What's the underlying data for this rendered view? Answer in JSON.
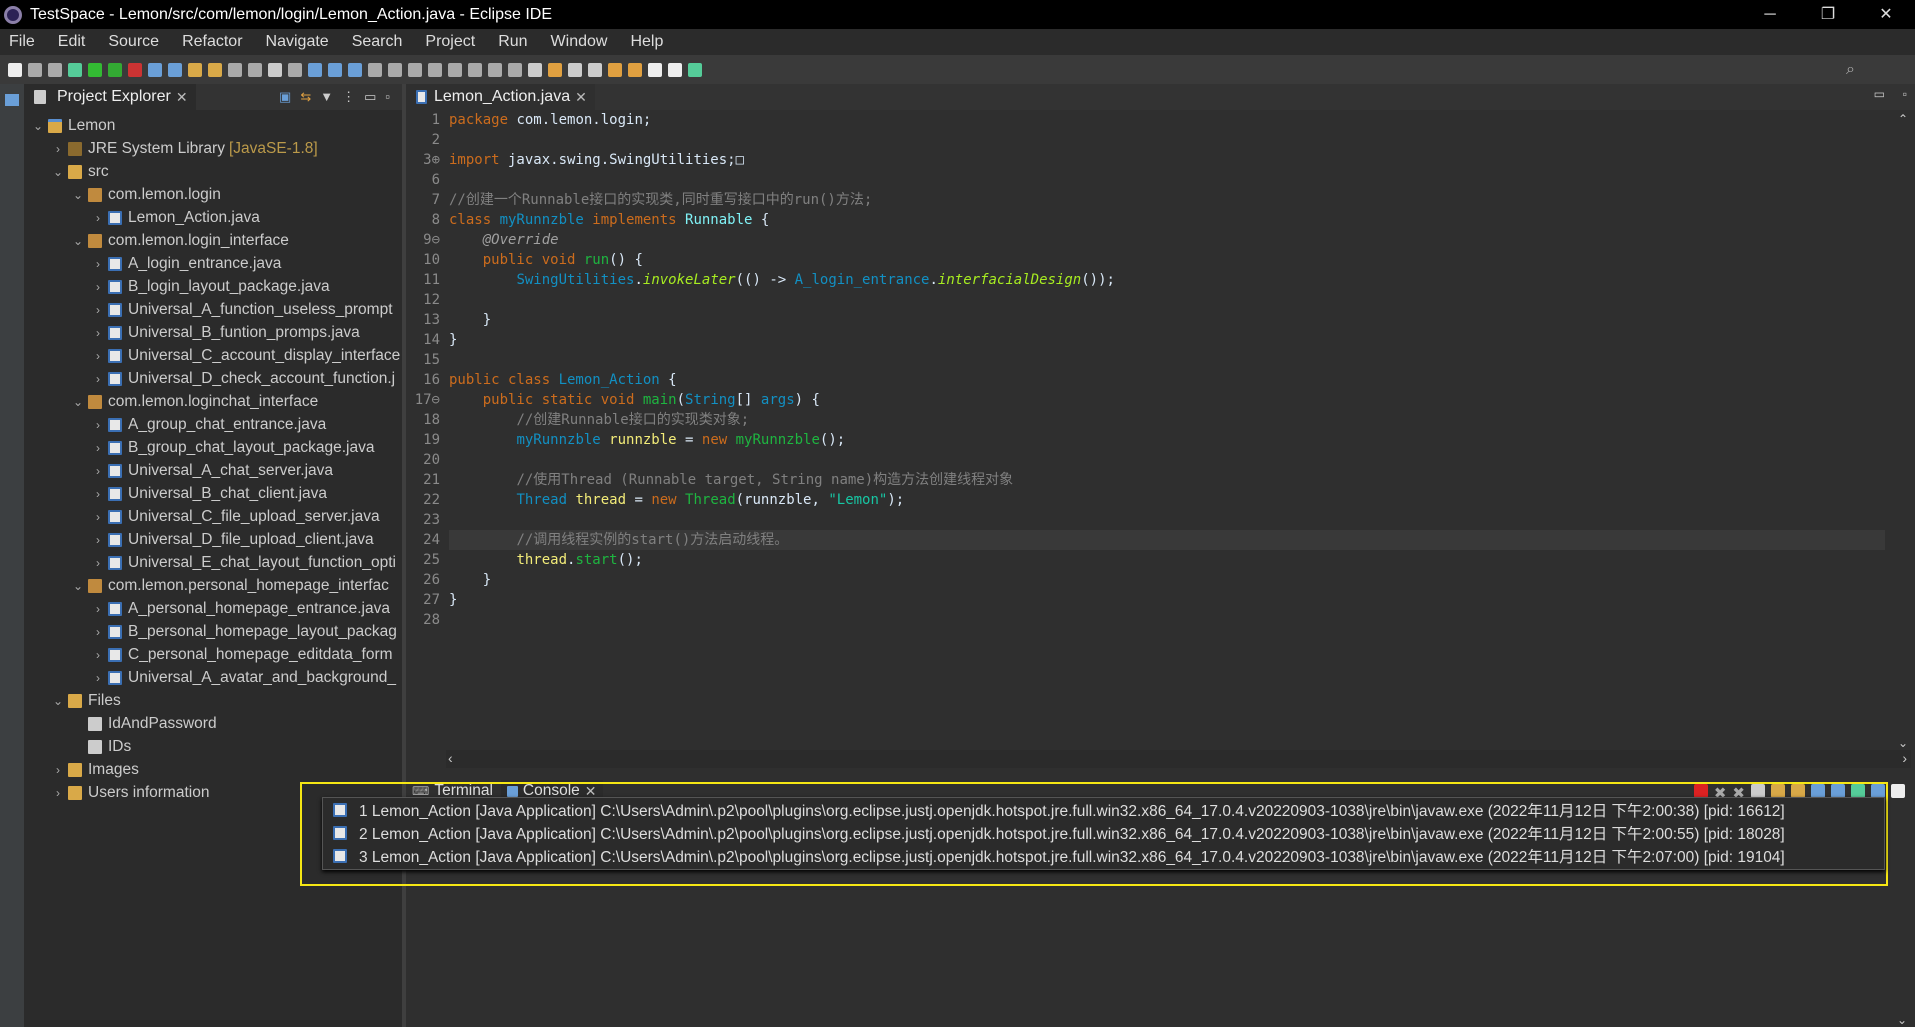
{
  "window": {
    "title": "TestSpace - Lemon/src/com/lemon/login/Lemon_Action.java - Eclipse IDE",
    "minimize": "─",
    "restore": "❐",
    "close": "✕"
  },
  "menu": [
    "File",
    "Edit",
    "Source",
    "Refactor",
    "Navigate",
    "Search",
    "Project",
    "Run",
    "Window",
    "Help"
  ],
  "explorer": {
    "title": "Project Explorer",
    "items": [
      {
        "depth": 0,
        "chev": "⌄",
        "icon": "project",
        "label": "Lemon"
      },
      {
        "depth": 1,
        "chev": "›",
        "icon": "library",
        "label": "JRE System Library",
        "decor": "[JavaSE-1.8]"
      },
      {
        "depth": 1,
        "chev": "⌄",
        "icon": "folder",
        "label": "src"
      },
      {
        "depth": 2,
        "chev": "⌄",
        "icon": "package",
        "label": "com.lemon.login"
      },
      {
        "depth": 3,
        "chev": "›",
        "icon": "java",
        "label": "Lemon_Action.java"
      },
      {
        "depth": 2,
        "chev": "⌄",
        "icon": "package",
        "label": "com.lemon.login_interface"
      },
      {
        "depth": 3,
        "chev": "›",
        "icon": "java",
        "label": "A_login_entrance.java"
      },
      {
        "depth": 3,
        "chev": "›",
        "icon": "java",
        "label": "B_login_layout_package.java"
      },
      {
        "depth": 3,
        "chev": "›",
        "icon": "java",
        "label": "Universal_A_function_useless_prompt"
      },
      {
        "depth": 3,
        "chev": "›",
        "icon": "java",
        "label": "Universal_B_funtion_promps.java"
      },
      {
        "depth": 3,
        "chev": "›",
        "icon": "java",
        "label": "Universal_C_account_display_interface"
      },
      {
        "depth": 3,
        "chev": "›",
        "icon": "java",
        "label": "Universal_D_check_account_function.j"
      },
      {
        "depth": 2,
        "chev": "⌄",
        "icon": "package",
        "label": "com.lemon.loginchat_interface"
      },
      {
        "depth": 3,
        "chev": "›",
        "icon": "java",
        "label": "A_group_chat_entrance.java"
      },
      {
        "depth": 3,
        "chev": "›",
        "icon": "java",
        "label": "B_group_chat_layout_package.java"
      },
      {
        "depth": 3,
        "chev": "›",
        "icon": "java",
        "label": "Universal_A_chat_server.java"
      },
      {
        "depth": 3,
        "chev": "›",
        "icon": "java",
        "label": "Universal_B_chat_client.java"
      },
      {
        "depth": 3,
        "chev": "›",
        "icon": "java",
        "label": "Universal_C_file_upload_server.java"
      },
      {
        "depth": 3,
        "chev": "›",
        "icon": "java",
        "label": "Universal_D_file_upload_client.java"
      },
      {
        "depth": 3,
        "chev": "›",
        "icon": "java",
        "label": "Universal_E_chat_layout_function_opti"
      },
      {
        "depth": 2,
        "chev": "⌄",
        "icon": "package",
        "label": "com.lemon.personal_homepage_interfac"
      },
      {
        "depth": 3,
        "chev": "›",
        "icon": "java",
        "label": "A_personal_homepage_entrance.java"
      },
      {
        "depth": 3,
        "chev": "›",
        "icon": "java",
        "label": "B_personal_homepage_layout_packag"
      },
      {
        "depth": 3,
        "chev": "›",
        "icon": "java",
        "label": "C_personal_homepage_editdata_form"
      },
      {
        "depth": 3,
        "chev": "›",
        "icon": "java",
        "label": "Universal_A_avatar_and_background_"
      },
      {
        "depth": 1,
        "chev": "⌄",
        "icon": "folder",
        "label": "Files"
      },
      {
        "depth": 2,
        "chev": "",
        "icon": "file",
        "label": "IdAndPassword"
      },
      {
        "depth": 2,
        "chev": "",
        "icon": "file",
        "label": "IDs"
      },
      {
        "depth": 1,
        "chev": "›",
        "icon": "folder",
        "label": "Images"
      },
      {
        "depth": 1,
        "chev": "›",
        "icon": "folder",
        "label": "Users information"
      }
    ]
  },
  "editor": {
    "tab": "Lemon_Action.java",
    "lines": [
      {
        "n": "1",
        "s": [
          [
            "kw",
            "package"
          ],
          [
            "plain",
            " com.lemon.login;"
          ]
        ]
      },
      {
        "n": "2",
        "s": []
      },
      {
        "n": "3⊕",
        "s": [
          [
            "kw",
            "import"
          ],
          [
            "plain",
            " javax.swing.SwingUtilities;□"
          ]
        ]
      },
      {
        "n": "6",
        "s": []
      },
      {
        "n": "7",
        "s": [
          [
            "cm",
            "//创建一个Runnable接口的实现类,同时重写接口中的run()方法;"
          ]
        ]
      },
      {
        "n": "8",
        "s": [
          [
            "kw",
            "class "
          ],
          [
            "cls",
            "myRunnzble "
          ],
          [
            "kw",
            "implements "
          ],
          [
            "ifc",
            "Runnable"
          ],
          [
            "plain",
            " {"
          ]
        ]
      },
      {
        "n": "9⊖",
        "s": [
          [
            "plain",
            "    "
          ],
          [
            "ann",
            "@Override"
          ]
        ]
      },
      {
        "n": "10",
        "s": [
          [
            "plain",
            "    "
          ],
          [
            "kw",
            "public void "
          ],
          [
            "mth",
            "run"
          ],
          [
            "plain",
            "() {"
          ]
        ]
      },
      {
        "n": "11",
        "s": [
          [
            "plain",
            "        "
          ],
          [
            "cls",
            "SwingUtilities"
          ],
          [
            "plain",
            "."
          ],
          [
            "it",
            "invokeLater"
          ],
          [
            "plain",
            "(() -> "
          ],
          [
            "cls",
            "A_login_entrance"
          ],
          [
            "plain",
            "."
          ],
          [
            "it",
            "interfacialDesign"
          ],
          [
            "plain",
            "());"
          ]
        ]
      },
      {
        "n": "12",
        "s": []
      },
      {
        "n": "13",
        "s": [
          [
            "plain",
            "    }"
          ]
        ]
      },
      {
        "n": "14",
        "s": [
          [
            "plain",
            "}"
          ]
        ]
      },
      {
        "n": "15",
        "s": []
      },
      {
        "n": "16",
        "s": [
          [
            "kw",
            "public class "
          ],
          [
            "cls",
            "Lemon_Action"
          ],
          [
            "plain",
            " {"
          ]
        ]
      },
      {
        "n": "17⊖",
        "s": [
          [
            "plain",
            "    "
          ],
          [
            "kw",
            "public static void "
          ],
          [
            "mth",
            "main"
          ],
          [
            "plain",
            "("
          ],
          [
            "cls",
            "String"
          ],
          [
            "plain",
            "[] "
          ],
          [
            "cls",
            "args"
          ],
          [
            "plain",
            ") {"
          ]
        ]
      },
      {
        "n": "18",
        "s": [
          [
            "plain",
            "        "
          ],
          [
            "cm",
            "//创建Runnable接口的实现类对象;"
          ]
        ]
      },
      {
        "n": "19",
        "s": [
          [
            "plain",
            "        "
          ],
          [
            "cls",
            "myRunnzble "
          ],
          [
            "var",
            "runnzble"
          ],
          [
            "plain",
            " = "
          ],
          [
            "kw",
            "new "
          ],
          [
            "mth",
            "myRunnzble"
          ],
          [
            "plain",
            "();"
          ]
        ]
      },
      {
        "n": "20",
        "s": []
      },
      {
        "n": "21",
        "s": [
          [
            "plain",
            "        "
          ],
          [
            "cm",
            "//使用Thread (Runnable target, String name)构造方法创建线程对象"
          ]
        ]
      },
      {
        "n": "22",
        "s": [
          [
            "plain",
            "        "
          ],
          [
            "cls",
            "Thread "
          ],
          [
            "var",
            "thread"
          ],
          [
            "plain",
            " = "
          ],
          [
            "kw",
            "new "
          ],
          [
            "mth",
            "Thread"
          ],
          [
            "plain",
            "(runnzble, "
          ],
          [
            "str",
            "\"Lemon\""
          ],
          [
            "plain",
            ");"
          ]
        ]
      },
      {
        "n": "23",
        "s": []
      },
      {
        "n": "24",
        "s": [
          [
            "plain",
            "        "
          ],
          [
            "cm",
            "//调用线程实例的start()方法启动线程。"
          ]
        ],
        "current": true
      },
      {
        "n": "25",
        "s": [
          [
            "plain",
            "        "
          ],
          [
            "var",
            "thread"
          ],
          [
            "plain",
            "."
          ],
          [
            "mth",
            "start"
          ],
          [
            "plain",
            "();"
          ]
        ]
      },
      {
        "n": "26",
        "s": [
          [
            "plain",
            "    }"
          ]
        ]
      },
      {
        "n": "27",
        "s": [
          [
            "plain",
            "}"
          ]
        ]
      },
      {
        "n": "28",
        "s": []
      }
    ]
  },
  "console": {
    "tabs": [
      "Terminal",
      "Console"
    ],
    "launches": [
      "1 Lemon_Action [Java Application] C:\\Users\\Admin\\.p2\\pool\\plugins\\org.eclipse.justj.openjdk.hotspot.jre.full.win32.x86_64_17.0.4.v20220903-1038\\jre\\bin\\javaw.exe  (2022年11月12日 下午2:00:38) [pid: 16612]",
      "2 Lemon_Action [Java Application] C:\\Users\\Admin\\.p2\\pool\\plugins\\org.eclipse.justj.openjdk.hotspot.jre.full.win32.x86_64_17.0.4.v20220903-1038\\jre\\bin\\javaw.exe  (2022年11月12日 下午2:00:55) [pid: 18028]",
      "3 Lemon_Action [Java Application] C:\\Users\\Admin\\.p2\\pool\\plugins\\org.eclipse.justj.openjdk.hotspot.jre.full.win32.x86_64_17.0.4.v20220903-1038\\jre\\bin\\javaw.exe  (2022年11月12日 下午2:07:00) [pid: 19104]"
    ]
  },
  "colors": {
    "highlight": "#f5e614",
    "keyword": "#cc6c1d",
    "class": "#1290c3",
    "method": "#1eb540"
  }
}
